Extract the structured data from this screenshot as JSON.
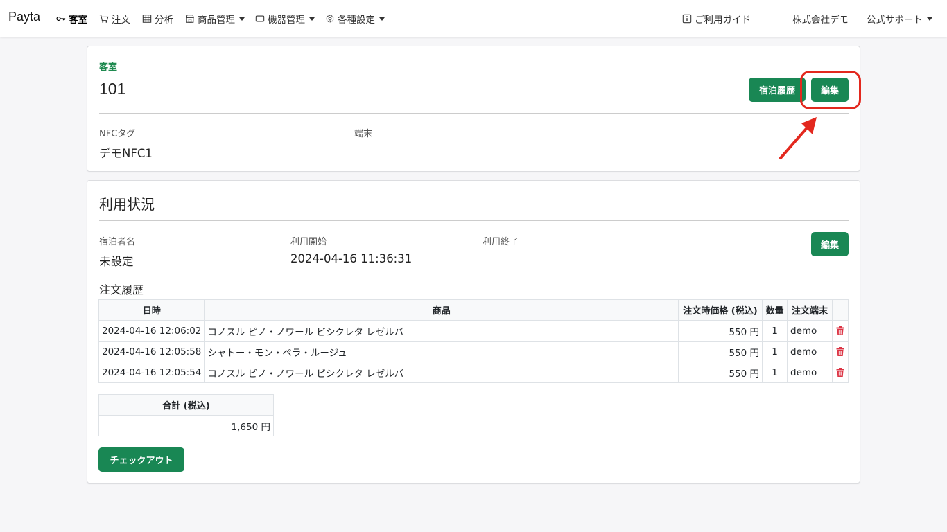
{
  "nav": {
    "brand": "Payta",
    "items": [
      {
        "label": "客室",
        "icon": "key-icon",
        "active": true
      },
      {
        "label": "注文",
        "icon": "cart-icon"
      },
      {
        "label": "分析",
        "icon": "table-icon"
      },
      {
        "label": "商品管理",
        "icon": "shop-icon",
        "dropdown": true
      },
      {
        "label": "機器管理",
        "icon": "device-icon",
        "dropdown": true
      },
      {
        "label": "各種設定",
        "icon": "gear-icon",
        "dropdown": true
      }
    ],
    "guide": "ご利用ガイド",
    "company": "株式会社デモ",
    "support": "公式サポート"
  },
  "room": {
    "section_label": "客室",
    "number": "101",
    "history_button": "宿泊履歴",
    "edit_button": "編集",
    "nfc_label": "NFCタグ",
    "nfc_value": "デモNFC1",
    "terminal_label": "端末",
    "terminal_value": ""
  },
  "usage": {
    "title": "利用状況",
    "guest_label": "宿泊者名",
    "guest_value": "未設定",
    "start_label": "利用開始",
    "start_value": "2024-04-16 11:36:31",
    "end_label": "利用終了",
    "end_value": "",
    "edit_button": "編集",
    "orders_title": "注文履歴",
    "table": {
      "headers": [
        "日時",
        "商品",
        "注文時価格 (税込)",
        "数量",
        "注文端末"
      ],
      "rows": [
        {
          "datetime": "2024-04-16 12:06:02",
          "product": "コノスル ピノ・ノワール ビシクレタ レゼルバ",
          "price": "550 円",
          "qty": "1",
          "terminal": "demo"
        },
        {
          "datetime": "2024-04-16 12:05:58",
          "product": "シャトー・モン・ペラ・ルージュ",
          "price": "550 円",
          "qty": "1",
          "terminal": "demo"
        },
        {
          "datetime": "2024-04-16 12:05:54",
          "product": "コノスル ピノ・ノワール ビシクレタ レゼルバ",
          "price": "550 円",
          "qty": "1",
          "terminal": "demo"
        }
      ]
    },
    "total_header": "合計 (税込)",
    "total_value": "1,650 円",
    "checkout_button": "チェックアウト"
  },
  "colors": {
    "accent": "#198754",
    "highlight": "#e3281e",
    "danger": "#dc3545"
  }
}
